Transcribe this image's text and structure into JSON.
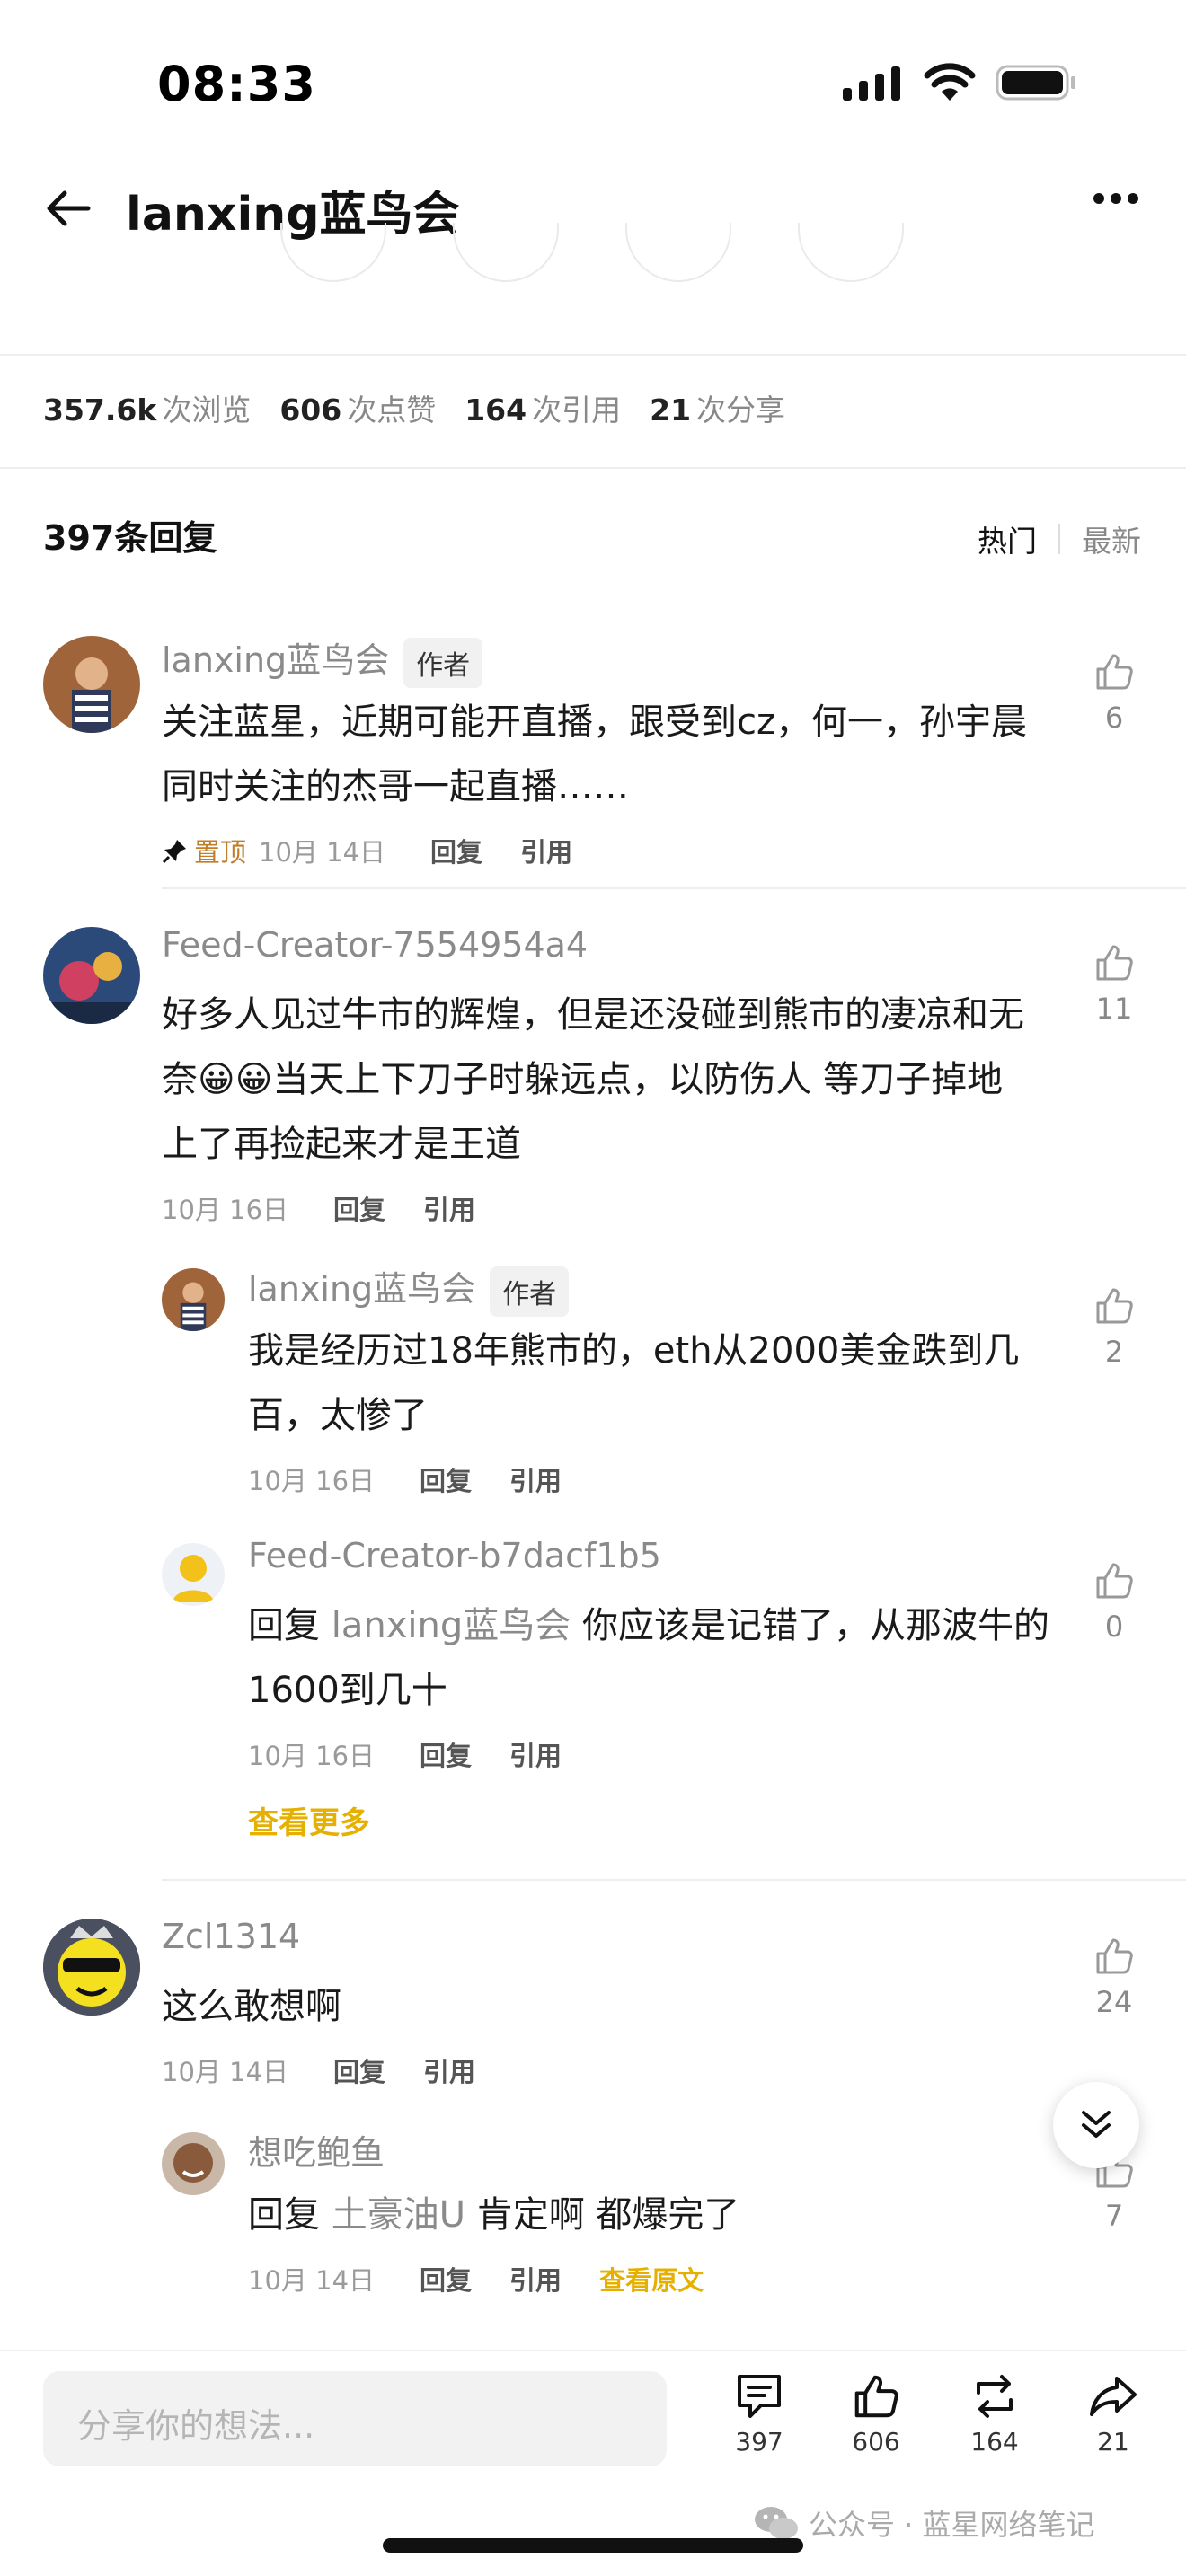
{
  "status": {
    "time": "08:33"
  },
  "nav": {
    "title": "lanxing蓝鸟会"
  },
  "stats": [
    {
      "value": "357.6k",
      "label": "次浏览"
    },
    {
      "value": "606",
      "label": "次点赞"
    },
    {
      "value": "164",
      "label": "次引用"
    },
    {
      "value": "21",
      "label": "次分享"
    }
  ],
  "replies": {
    "count_label": "397条回复",
    "sort_hot": "热门",
    "sort_new": "最新"
  },
  "comments": [
    {
      "name": "lanxing蓝鸟会",
      "tag": "作者",
      "text_lines": [
        "关注蓝星，近期可能开直播，跟受到cz，何一，孙宇晨",
        "同时关注的杰哥一起直播……"
      ],
      "pinned": "置顶",
      "date": "10月 14日",
      "reply": "回复",
      "quote": "引用",
      "likes": "6"
    },
    {
      "name": "Feed-Creator-7554954a4",
      "text_lines": [
        "好多人见过牛市的辉煌，但是还没碰到熊市的凄凉和无",
        "奈😀😀当天上下刀子时躲远点，以防伤人 等刀子掉地",
        "上了再捡起来才是王道"
      ],
      "date": "10月 16日",
      "reply": "回复",
      "quote": "引用",
      "likes": "11"
    },
    {
      "name": "lanxing蓝鸟会",
      "tag": "作者",
      "text_lines": [
        "我是经历过18年熊市的，eth从2000美金跌到几",
        "百，太惨了"
      ],
      "date": "10月 16日",
      "reply": "回复",
      "quote": "引用",
      "likes": "2"
    },
    {
      "name": "Feed-Creator-b7dacf1b5",
      "reply_prefix": "回复",
      "reply_to": "lanxing蓝鸟会",
      "text_rest": "你应该是记错了，从那波牛的",
      "text_line2": "1600到几十",
      "date": "10月 16日",
      "reply": "回复",
      "quote": "引用",
      "likes": "0",
      "see_more": "查看更多"
    },
    {
      "name": "Zcl1314",
      "text_lines": [
        "这么敢想啊"
      ],
      "date": "10月 14日",
      "reply": "回复",
      "quote": "引用",
      "likes": "24"
    },
    {
      "name": "想吃鲍鱼",
      "reply_prefix": "回复",
      "reply_to": "土豪油U",
      "text_rest": "肯定啊 都爆完了",
      "date": "10月 14日",
      "reply": "回复",
      "quote": "引用",
      "view_original": "查看原文",
      "likes": "7"
    }
  ],
  "bottom": {
    "placeholder": "分享你的想法...",
    "comments": "397",
    "likes": "606",
    "reposts": "164",
    "shares": "21"
  },
  "watermark": "公众号 · 蓝星网络笔记",
  "colors": {
    "accent": "#e5b000",
    "pin": "#c07d2a",
    "muted": "#8a8a8a"
  }
}
